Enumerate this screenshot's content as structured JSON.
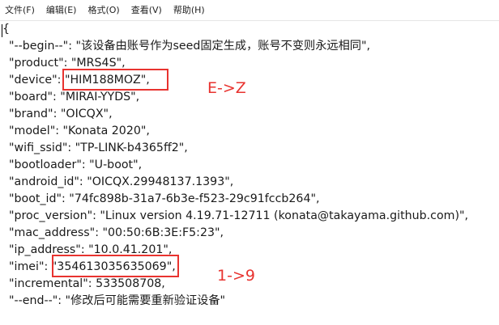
{
  "menu": [
    {
      "label": "文件(F)"
    },
    {
      "label": "编辑(E)"
    },
    {
      "label": "格式(O)"
    },
    {
      "label": "查看(V)"
    },
    {
      "label": "帮助(H)"
    }
  ],
  "lines": [
    "{",
    "\"--begin--\": \"该设备由账号作为seed固定生成，账号不变则永远相同\",",
    "\"product\": \"MRS4S\",",
    "\"device\": \"HIM188MOZ\",",
    "\"board\": \"MIRAI-YYDS\",",
    "\"brand\": \"OICQX\",",
    "\"model\": \"Konata 2020\",",
    "\"wifi_ssid\": \"TP-LINK-b4365ff2\",",
    "\"bootloader\": \"U-boot\",",
    "\"android_id\": \"OICQX.29948137.1393\",",
    "\"boot_id\": \"74fc898b-31a7-6b3e-f523-29c91fccb264\",",
    "\"proc_version\": \"Linux version 4.19.71-12711 (konata@takayama.github.com)\",",
    "\"mac_address\": \"00:50:6B:3E:F5:23\",",
    "\"ip_address\": \"10.0.41.201\",",
    "\"imei\": \"354613035635069\",",
    "\"incremental\": 533508708,",
    "\"--end--\": \"修改后可能需要重新验证设备\""
  ],
  "annotations": {
    "device_note": "E->Z",
    "imei_note": "1->9"
  },
  "colors": {
    "highlight": "#e8332f",
    "text": "#1a1a1a"
  }
}
